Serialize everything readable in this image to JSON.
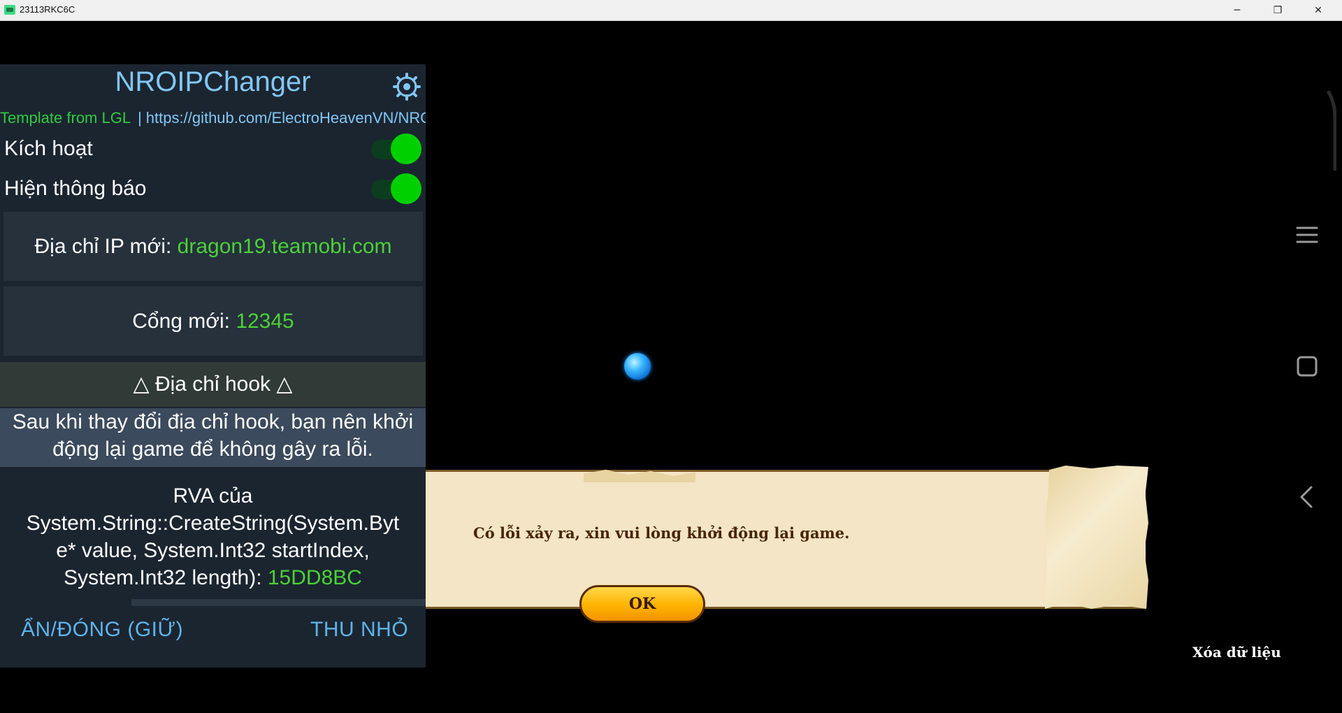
{
  "window": {
    "title": "23113RKC6C",
    "controls": {
      "minimize": "─",
      "maximize": "❐",
      "close": "✕"
    }
  },
  "mod_menu": {
    "title": "NROIPChanger",
    "credits": {
      "template": "Template from LGL",
      "separator": "|",
      "url": "https://github.com/ElectroHeavenVN/NROIPChanger"
    },
    "toggles": [
      {
        "label": "Kích hoạt",
        "on": true
      },
      {
        "label": "Hiện thông báo",
        "on": true
      }
    ],
    "ip": {
      "label": "Địa chỉ IP mới: ",
      "value": "dragon19.teamobi.com"
    },
    "port": {
      "label": "Cổng mới: ",
      "value": "12345"
    },
    "hook_section": {
      "label": "△ Địa chỉ hook △"
    },
    "notice": "Sau khi thay đổi địa chỉ hook, bạn nên khởi động lại game để không gây ra lỗi.",
    "rva": {
      "line1": "RVA của",
      "line2": "System.String::CreateString(System.Byt",
      "line3": "e* value, System.Int32 startIndex,",
      "line4": "System.Int32 length): ",
      "value": "15DD8BC"
    },
    "footer": {
      "hide_close": "ẨN/ĐÓNG (GIỮ)",
      "minimize": "THU NHỎ"
    }
  },
  "game": {
    "dialog_message": "Có lỗi xảy ra, xin vui lòng khởi động lại game.",
    "ok_label": "OK",
    "clear_data": "Xóa dữ liệu"
  },
  "colors": {
    "panel_bg": "#1b2530",
    "title_blue": "#82c7f6",
    "value_green": "#4cd137",
    "toggle_on": "#00d000"
  }
}
